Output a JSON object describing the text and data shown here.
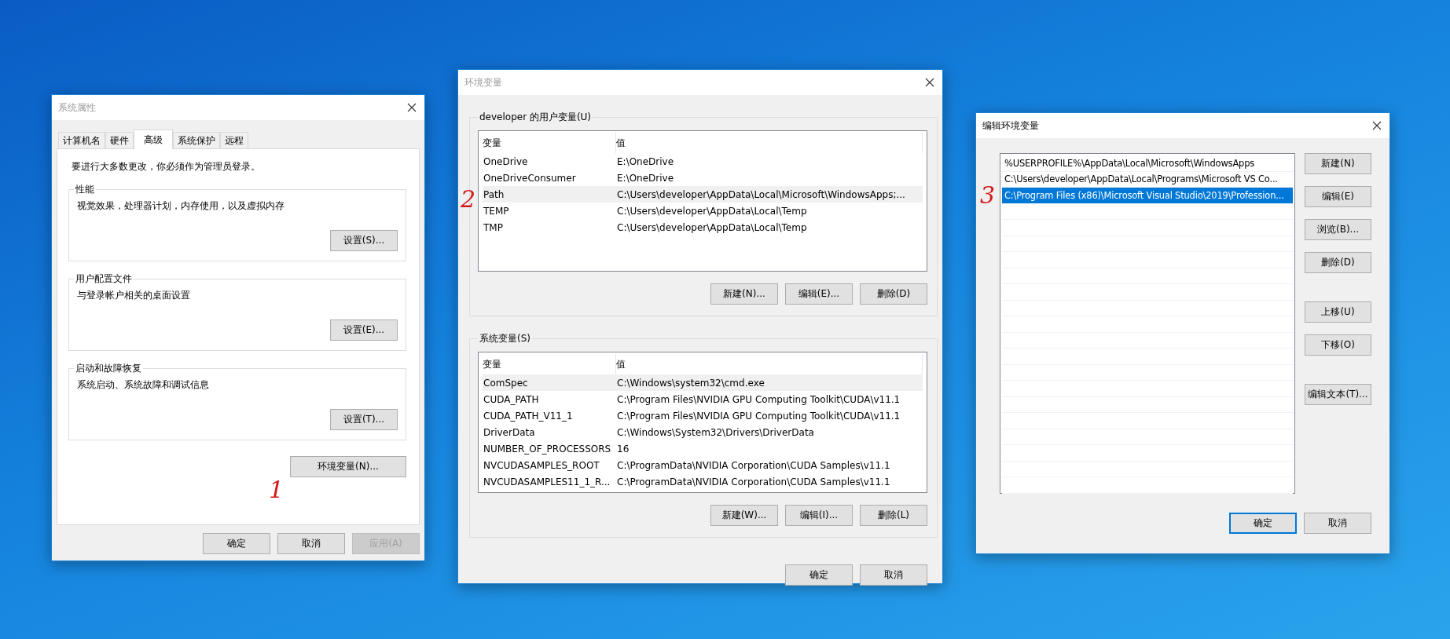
{
  "windows": [
    {
      "kind": "system_properties",
      "title": "系统属性",
      "active": false,
      "tabs": [
        {
          "label": "计算机名",
          "selected": false
        },
        {
          "label": "硬件",
          "selected": false
        },
        {
          "label": "高级",
          "selected": true
        },
        {
          "label": "系统保护",
          "selected": false
        },
        {
          "label": "远程",
          "selected": false
        }
      ],
      "notice": "要进行大多数更改，你必须作为管理员登录。",
      "groups": [
        {
          "title": "性能",
          "description": "视觉效果，处理器计划，内存使用，以及虚拟内存",
          "button": "设置(S)..."
        },
        {
          "title": "用户配置文件",
          "description": "与登录帐户相关的桌面设置",
          "button": "设置(E)..."
        },
        {
          "title": "启动和故障恢复",
          "description": "系统启动、系统故障和调试信息",
          "button": "设置(T)..."
        }
      ],
      "env_button": "环境变量(N)...",
      "annotation": "1",
      "buttons": [
        {
          "label": "确定",
          "disabled": false,
          "default": false
        },
        {
          "label": "取消",
          "disabled": false,
          "default": false
        },
        {
          "label": "应用(A)",
          "disabled": true,
          "default": false
        }
      ]
    },
    {
      "kind": "environment_variables",
      "title": "环境变量",
      "active": false,
      "annotation": "2",
      "sections": [
        {
          "title": "developer 的用户变量(U)",
          "columns": [
            "变量",
            "值"
          ],
          "rows": [
            {
              "name": "OneDrive",
              "value": "E:\\OneDrive",
              "selected": false
            },
            {
              "name": "OneDriveConsumer",
              "value": "E:\\OneDrive",
              "selected": false
            },
            {
              "name": "Path",
              "value": "C:\\Users\\developer\\AppData\\Local\\Microsoft\\WindowsApps;...",
              "selected": true
            },
            {
              "name": "TEMP",
              "value": "C:\\Users\\developer\\AppData\\Local\\Temp",
              "selected": false
            },
            {
              "name": "TMP",
              "value": "C:\\Users\\developer\\AppData\\Local\\Temp",
              "selected": false
            }
          ],
          "buttons": [
            "新建(N)...",
            "编辑(E)...",
            "删除(D)"
          ]
        },
        {
          "title": "系统变量(S)",
          "columns": [
            "变量",
            "值"
          ],
          "rows": [
            {
              "name": "ComSpec",
              "value": "C:\\Windows\\system32\\cmd.exe",
              "selected": true
            },
            {
              "name": "CUDA_PATH",
              "value": "C:\\Program Files\\NVIDIA GPU Computing Toolkit\\CUDA\\v11.1",
              "selected": false
            },
            {
              "name": "CUDA_PATH_V11_1",
              "value": "C:\\Program Files\\NVIDIA GPU Computing Toolkit\\CUDA\\v11.1",
              "selected": false
            },
            {
              "name": "DriverData",
              "value": "C:\\Windows\\System32\\Drivers\\DriverData",
              "selected": false
            },
            {
              "name": "NUMBER_OF_PROCESSORS",
              "value": "16",
              "selected": false
            },
            {
              "name": "NVCUDASAMPLES_ROOT",
              "value": "C:\\ProgramData\\NVIDIA Corporation\\CUDA Samples\\v11.1",
              "selected": false
            },
            {
              "name": "NVCUDASAMPLES11_1_R...",
              "value": "C:\\ProgramData\\NVIDIA Corporation\\CUDA Samples\\v11.1",
              "selected": false
            }
          ],
          "buttons": [
            "新建(W)...",
            "编辑(I)...",
            "删除(L)"
          ]
        }
      ],
      "buttons": [
        {
          "label": "确定",
          "disabled": false,
          "default": false
        },
        {
          "label": "取消",
          "disabled": false,
          "default": false
        }
      ]
    },
    {
      "kind": "edit_variable",
      "title": "编辑环境变量",
      "active": true,
      "annotation": "3",
      "entries": [
        {
          "text": "%USERPROFILE%\\AppData\\Local\\Microsoft\\WindowsApps",
          "selected": false
        },
        {
          "text": "C:\\Users\\developer\\AppData\\Local\\Programs\\Microsoft VS Co...",
          "selected": false
        },
        {
          "text": "C:\\Program Files (x86)\\Microsoft Visual Studio\\2019\\Profession...",
          "selected": true
        }
      ],
      "side_button_groups": [
        [
          "新建(N)",
          "编辑(E)",
          "浏览(B)...",
          "删除(D)"
        ],
        [
          "上移(U)",
          "下移(O)"
        ],
        [
          "编辑文本(T)..."
        ]
      ],
      "buttons": [
        {
          "label": "确定",
          "disabled": false,
          "default": true
        },
        {
          "label": "取消",
          "disabled": false,
          "default": false
        }
      ]
    }
  ]
}
